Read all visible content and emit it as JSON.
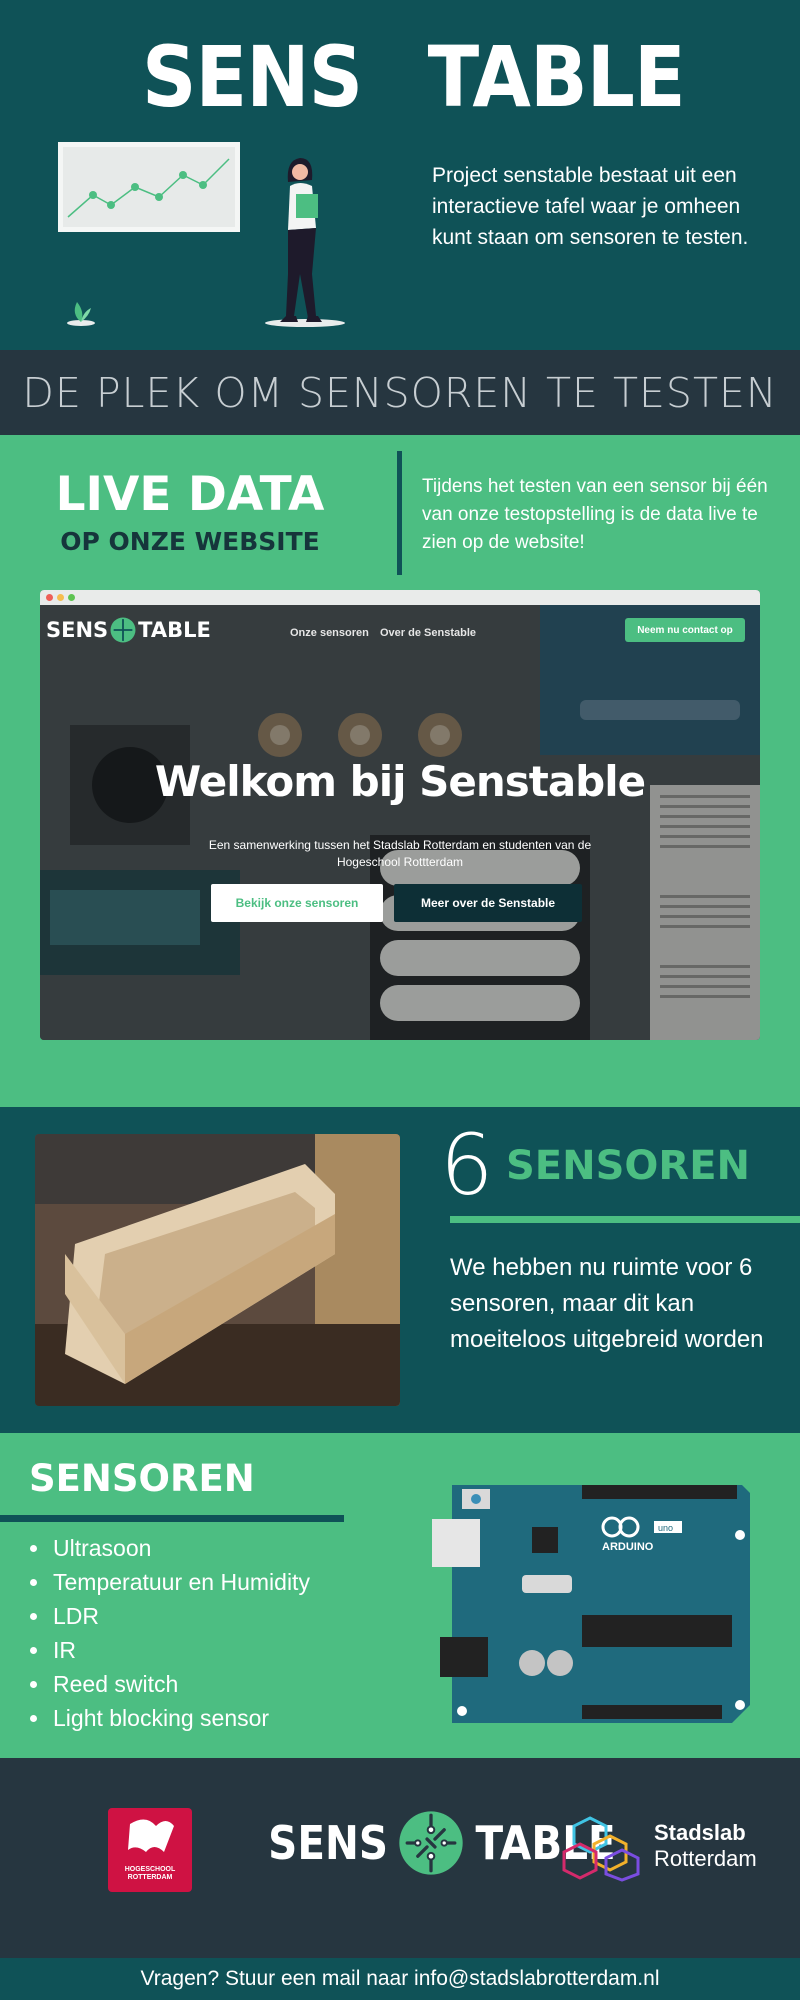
{
  "header": {
    "logo_left": "SENS",
    "logo_right": "TABLE",
    "intro": "Project senstable bestaat uit een interactieve tafel waar je omheen kunt staan om sensoren te testen."
  },
  "banner": {
    "text": "DE PLEK OM SENSOREN TE TESTEN"
  },
  "live": {
    "title": "LIVE DATA",
    "subtitle": "OP ONZE WEBSITE",
    "description": "Tijdens het testen van een sensor bij één van onze testopstelling is de data live te zien op de website!"
  },
  "website": {
    "logo_left": "SENS",
    "logo_right": "TABLE",
    "nav": [
      "Onze sensoren",
      "Over de Senstable"
    ],
    "cta": "Neem nu contact op",
    "title": "Welkom bij Senstable",
    "subtitle": "Een samenwerking tussen het Stadslab Rotterdam en studenten van de Hogeschool Rottterdam",
    "button_primary": "Bekijk onze sensoren",
    "button_secondary": "Meer over de Senstable"
  },
  "count": {
    "number": "6",
    "label": "SENSOREN",
    "text": "We hebben nu ruimte voor 6 sensoren, maar dit kan moeiteloos uitgebreid worden"
  },
  "sensors": {
    "title": "SENSOREN",
    "items": [
      "Ultrasoon",
      "Temperatuur en Humidity",
      "LDR",
      "IR",
      "Reed switch",
      "Light blocking sensor"
    ]
  },
  "footer": {
    "hr_line1": "HOGESCHOOL",
    "hr_line2": "ROTTERDAM",
    "logo_left": "SENS",
    "logo_right": "TABLE",
    "stadslab_line1": "Stadslab",
    "stadslab_line2": "Rotterdam",
    "contact": "Vragen? Stuur een mail naar info@stadslabrotterdam.nl"
  },
  "colors": {
    "dark_teal": "#0f5257",
    "green": "#4cbe82",
    "slate": "#263640",
    "hr_red": "#cf1243"
  }
}
